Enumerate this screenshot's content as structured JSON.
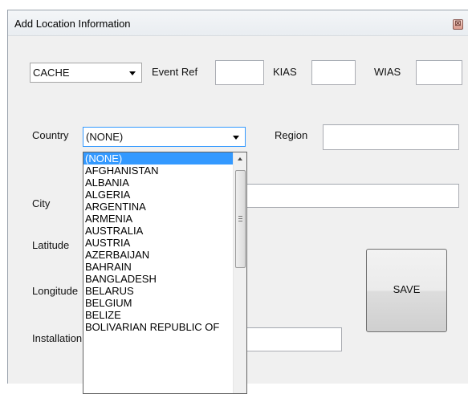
{
  "window": {
    "title": "Add Location Information",
    "close_glyph": "⊠"
  },
  "form": {
    "type_combo": {
      "value": "CACHE"
    },
    "event_ref": {
      "label": "Event Ref",
      "value": ""
    },
    "kias": {
      "label": "KIAS",
      "value": ""
    },
    "wias": {
      "label": "WIAS",
      "value": ""
    },
    "country": {
      "label": "Country",
      "value": "(NONE)"
    },
    "region": {
      "label": "Region",
      "value": ""
    },
    "city": {
      "label": "City",
      "value": ""
    },
    "latitude": {
      "label": "Latitude"
    },
    "longitude": {
      "label": "Longitude"
    },
    "installation": {
      "label": "Installation",
      "value": ""
    },
    "save_label": "SAVE"
  },
  "country_dropdown": {
    "selected_index": 0,
    "items": [
      "(NONE)",
      "AFGHANISTAN",
      "ALBANIA",
      "ALGERIA",
      "ARGENTINA",
      "ARMENIA",
      "AUSTRALIA",
      "AUSTRIA",
      "AZERBAIJAN",
      "BAHRAIN",
      "BANGLADESH",
      "BELARUS",
      "BELGIUM",
      "BELIZE",
      "BOLIVARIAN REPUBLIC OF"
    ]
  },
  "colors": {
    "selection": "#3399ff",
    "window_bg": "#f0f0f0"
  }
}
